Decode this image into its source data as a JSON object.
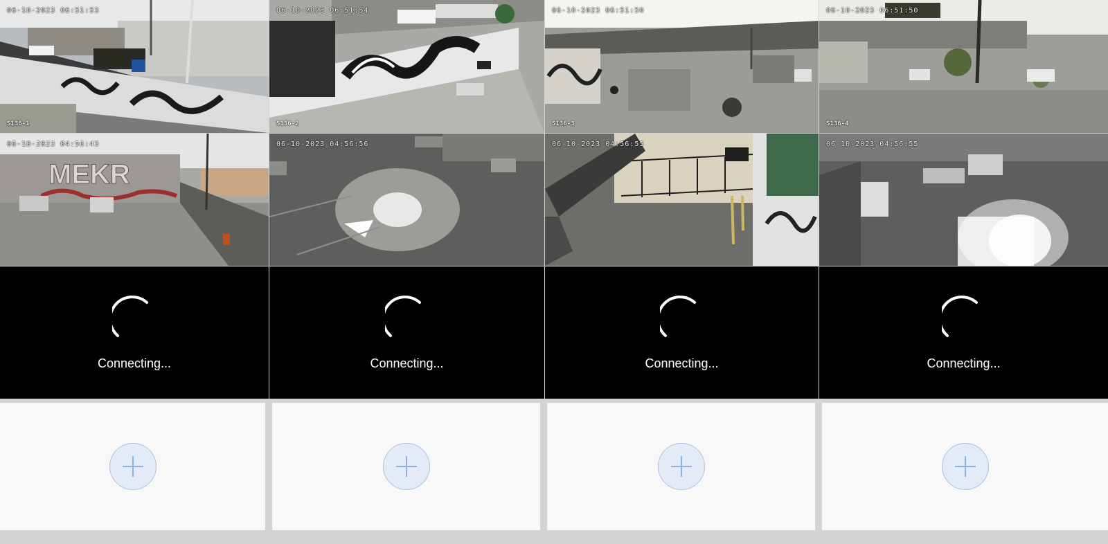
{
  "cameras": [
    {
      "timestamp": "06-10-2023 06:51:53",
      "label": "S136-1",
      "scene": "street-graffiti-wall"
    },
    {
      "timestamp": "06-10-2023 06:51:54",
      "label": "S136-2",
      "scene": "lot-wall-graffiti"
    },
    {
      "timestamp": "06-10-2023 06:51:50",
      "label": "S136-3",
      "scene": "covered-lot-debris"
    },
    {
      "timestamp": "06-10-2023 06:51:50",
      "label": "S136-4",
      "scene": "open-lot-debris"
    },
    {
      "timestamp": "06-10-2023 04:56:43",
      "label": "",
      "scene": "parking-lot-mekr-wall"
    },
    {
      "timestamp": "06-10-2023 04:56:56",
      "label": "",
      "scene": "night-parking-lot"
    },
    {
      "timestamp": "06-10-2023 04:56:55",
      "label": "",
      "scene": "fence-corner-night"
    },
    {
      "timestamp": "06-10-2023 04:56:55",
      "label": "",
      "scene": "night-lot-bright-light"
    }
  ],
  "connecting": [
    {
      "label": "Connecting..."
    },
    {
      "label": "Connecting..."
    },
    {
      "label": "Connecting..."
    },
    {
      "label": "Connecting..."
    }
  ],
  "empty_slots": [
    {
      "icon": "plus-icon"
    },
    {
      "icon": "plus-icon"
    },
    {
      "icon": "plus-icon"
    },
    {
      "icon": "plus-icon"
    }
  ],
  "colors": {
    "connecting_bg": "#000000",
    "empty_bg": "#f8f8f8",
    "add_button_fill": "#e3ebf6",
    "add_button_border": "#a9c1e2",
    "grid_gap": "#d4d4d4"
  }
}
